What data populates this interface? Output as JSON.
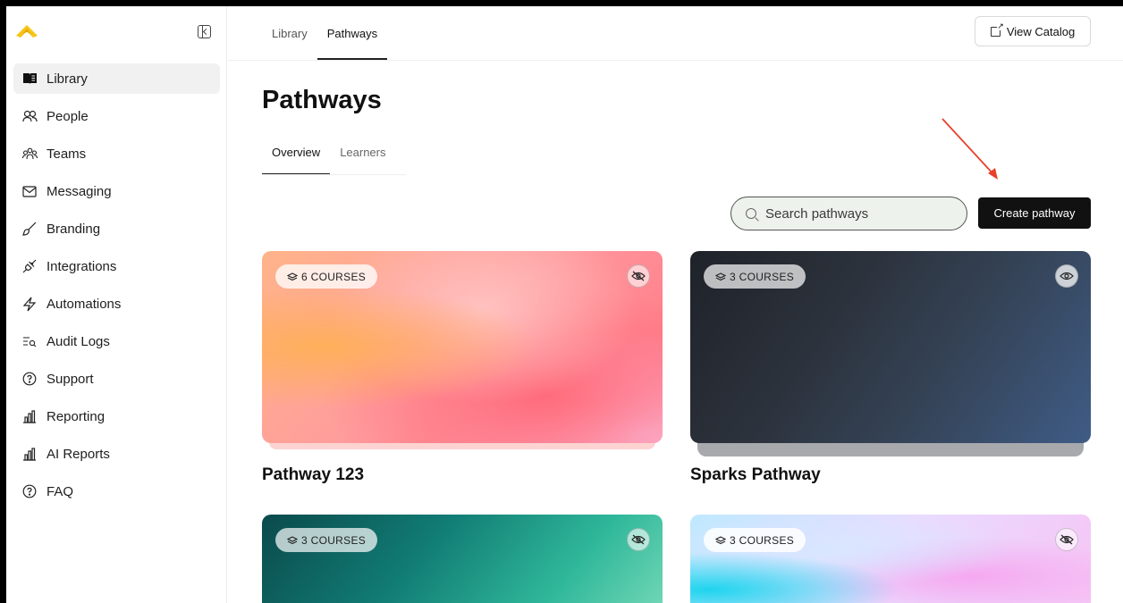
{
  "sidebar": {
    "items": [
      {
        "label": "Library",
        "icon": "book-open-icon",
        "active": true
      },
      {
        "label": "People",
        "icon": "people-icon"
      },
      {
        "label": "Teams",
        "icon": "teams-icon"
      },
      {
        "label": "Messaging",
        "icon": "envelope-icon"
      },
      {
        "label": "Branding",
        "icon": "brush-icon"
      },
      {
        "label": "Integrations",
        "icon": "plug-icon"
      },
      {
        "label": "Automations",
        "icon": "lightning-icon"
      },
      {
        "label": "Audit Logs",
        "icon": "audit-list-icon"
      },
      {
        "label": "Support",
        "icon": "question-circle-icon"
      },
      {
        "label": "Reporting",
        "icon": "bar-chart-icon"
      },
      {
        "label": "AI Reports",
        "icon": "bar-chart-icon"
      },
      {
        "label": "FAQ",
        "icon": "question-circle-icon"
      }
    ]
  },
  "header": {
    "tabs": [
      {
        "label": "Library"
      },
      {
        "label": "Pathways",
        "active": true
      }
    ],
    "view_catalog_label": "View Catalog"
  },
  "main": {
    "title": "Pathways",
    "subtabs": [
      {
        "label": "Overview",
        "active": true
      },
      {
        "label": "Learners"
      }
    ],
    "search_placeholder": "Search pathways",
    "create_label": "Create pathway",
    "cards": [
      {
        "title": "Pathway 123",
        "badge": "6 COURSES",
        "visibility_icon": "eye-off-icon"
      },
      {
        "title": "Sparks Pathway",
        "badge": "3 COURSES",
        "visibility_icon": "eye-icon"
      },
      {
        "title": "",
        "badge": "3 COURSES",
        "visibility_icon": "eye-off-icon"
      },
      {
        "title": "",
        "badge": "3 COURSES",
        "visibility_icon": "eye-off-icon"
      }
    ]
  },
  "colors": {
    "accent_logo": "#f5c518",
    "primary_button": "#111111",
    "annotation_arrow": "#e8412c"
  }
}
